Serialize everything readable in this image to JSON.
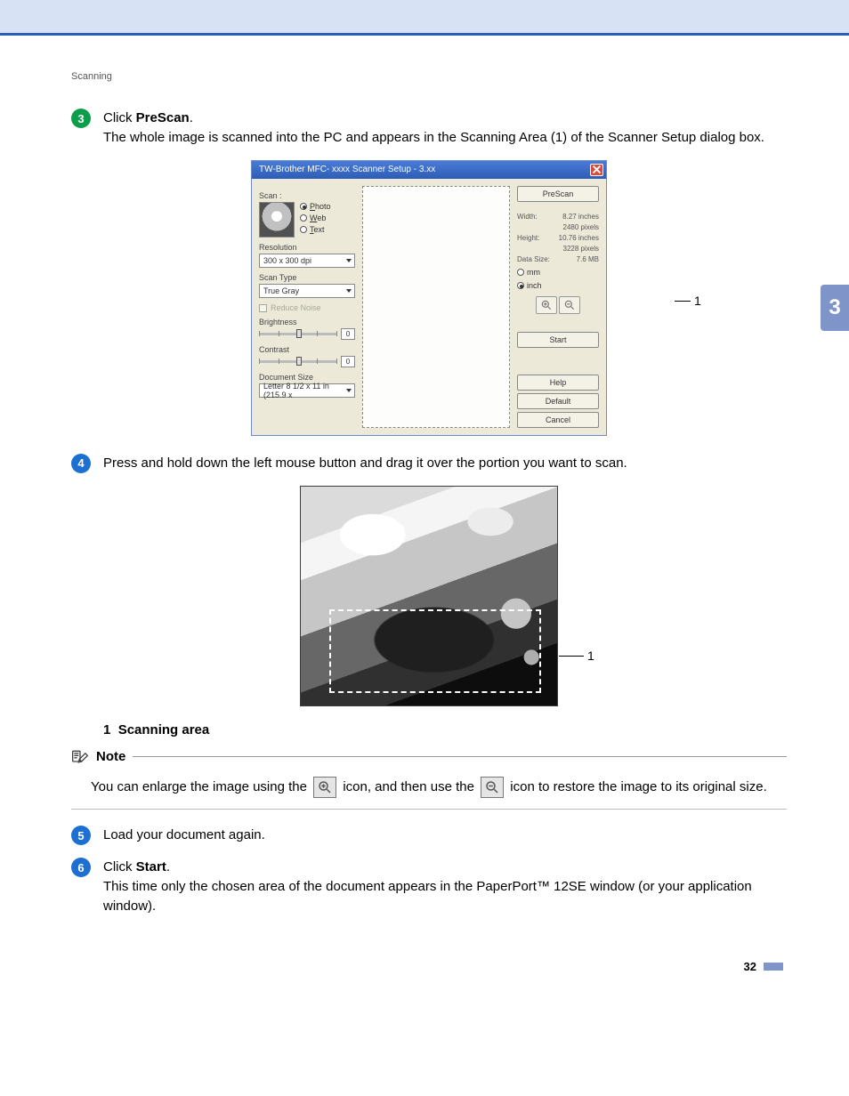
{
  "header": {
    "section_label": "Scanning"
  },
  "sidetab": {
    "number": "3"
  },
  "steps": {
    "s3": {
      "num": "3",
      "line1_prefix": "Click ",
      "line1_bold": "PreScan",
      "line1_suffix": ".",
      "line2": "The whole image is scanned into the PC and appears in the Scanning Area (1) of the Scanner Setup dialog box."
    },
    "s4": {
      "num": "4",
      "text": "Press and hold down the left mouse button and drag it over the portion you want to scan."
    },
    "s5": {
      "num": "5",
      "text": "Load your document again."
    },
    "s6": {
      "num": "6",
      "line1_prefix": "Click ",
      "line1_bold": "Start",
      "line1_suffix": ".",
      "line2": "This time only the chosen area of the document appears in the PaperPort™ 12SE window (or your application window)."
    }
  },
  "dialog": {
    "title": "TW-Brother MFC- xxxx Scanner Setup - 3.xx",
    "scan_label": "Scan :",
    "radios": {
      "photo": "Photo",
      "web": "Web",
      "text": "Text"
    },
    "resolution_label": "Resolution",
    "resolution_value": "300 x 300 dpi",
    "scantype_label": "Scan Type",
    "scantype_value": "True Gray",
    "reduce_noise": "Reduce Noise",
    "brightness_label": "Brightness",
    "brightness_value": "0",
    "contrast_label": "Contrast",
    "contrast_value": "0",
    "docsize_label": "Document Size",
    "docsize_value": "Letter 8 1/2 x 11 in (215.9 x ",
    "buttons": {
      "prescan": "PreScan",
      "start": "Start",
      "help": "Help",
      "default": "Default",
      "cancel": "Cancel"
    },
    "info": {
      "width_lbl": "Width:",
      "width_val": "8.27 inches",
      "width_px": "2480 pixels",
      "height_lbl": "Height:",
      "height_val": "10.76 inches",
      "height_px": "3228 pixels",
      "datasize_lbl": "Data Size:",
      "datasize_val": "7.6 MB"
    },
    "units": {
      "mm": "mm",
      "inch": "inch"
    },
    "callout": "1"
  },
  "food_callout": "1",
  "scan_area": {
    "num": "1",
    "label": "Scanning area"
  },
  "note": {
    "heading": "Note",
    "part1": "You can enlarge the image using the ",
    "part2": " icon, and then use the ",
    "part3": " icon to restore the image to its original size."
  },
  "footer": {
    "page": "32"
  }
}
